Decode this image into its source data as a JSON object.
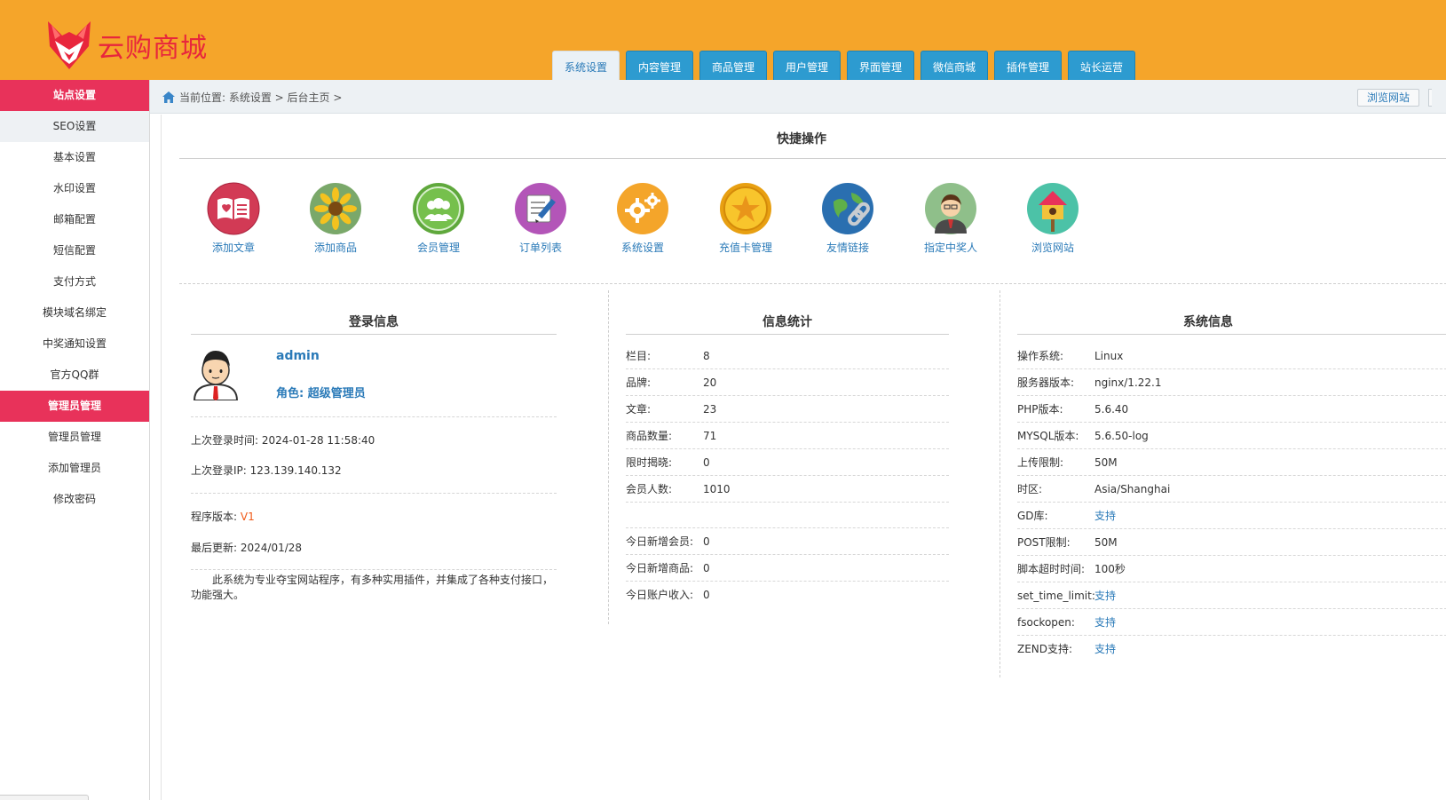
{
  "app": {
    "name": "云购商城"
  },
  "tabs": [
    {
      "label": "系统设置",
      "active": true
    },
    {
      "label": "内容管理"
    },
    {
      "label": "商品管理"
    },
    {
      "label": "用户管理"
    },
    {
      "label": "界面管理"
    },
    {
      "label": "微信商城"
    },
    {
      "label": "插件管理"
    },
    {
      "label": "站长运营"
    }
  ],
  "sidebar": {
    "group1": "站点设置",
    "items1": [
      "SEO设置",
      "基本设置",
      "水印设置",
      "邮箱配置",
      "短信配置",
      "支付方式",
      "模块域名绑定",
      "中奖通知设置",
      "官方QQ群"
    ],
    "group2": "管理员管理",
    "items2": [
      "管理员管理",
      "添加管理员",
      "修改密码"
    ]
  },
  "breadcrumb": {
    "text": "当前位置: 系统设置 > 后台主页 >"
  },
  "visit_site_button": "浏览网站",
  "quick_actions": {
    "title": "快捷操作",
    "items": [
      {
        "label": "添加文章",
        "icon": "book-icon"
      },
      {
        "label": "添加商品",
        "icon": "sunflower-icon"
      },
      {
        "label": "会员管理",
        "icon": "members-icon"
      },
      {
        "label": "订单列表",
        "icon": "notepad-icon"
      },
      {
        "label": "系统设置",
        "icon": "gears-icon"
      },
      {
        "label": "充值卡管理",
        "icon": "coin-icon"
      },
      {
        "label": "友情链接",
        "icon": "globe-link-icon"
      },
      {
        "label": "指定中奖人",
        "icon": "person-icon"
      },
      {
        "label": "浏览网站",
        "icon": "birdhouse-icon"
      }
    ]
  },
  "login_info": {
    "title": "登录信息",
    "username": "admin",
    "role": "角色: 超级管理员",
    "last_login_time": "上次登录时间: 2024-01-28 11:58:40",
    "last_login_ip": "上次登录IP: 123.139.140.132",
    "version_label": "程序版本: ",
    "version_value": "V1",
    "last_update": "最后更新: 2024/01/28",
    "description_line1": "此系统为专业夺宝网站程序，有多种实用插件，并集成了各种支付接口，功",
    "description_line2": "能强大。"
  },
  "stats": {
    "title": "信息统计",
    "rows": [
      {
        "k": "栏目:",
        "v": "8"
      },
      {
        "k": "品牌:",
        "v": "20"
      },
      {
        "k": "文章:",
        "v": "23"
      },
      {
        "k": "商品数量:",
        "v": "71"
      },
      {
        "k": "限时揭晓:",
        "v": "0"
      },
      {
        "k": "会员人数:",
        "v": "1010"
      }
    ],
    "today_rows": [
      {
        "k": "今日新增会员:",
        "v": "0"
      },
      {
        "k": "今日新增商品:",
        "v": "0"
      },
      {
        "k": "今日账户收入:",
        "v": "0"
      }
    ]
  },
  "system_info": {
    "title": "系统信息",
    "rows": [
      {
        "k": "操作系统:",
        "v": "Linux"
      },
      {
        "k": "服务器版本:",
        "v": "nginx/1.22.1"
      },
      {
        "k": "PHP版本:",
        "v": "5.6.40"
      },
      {
        "k": "MYSQL版本:",
        "v": "5.6.50-log"
      },
      {
        "k": "上传限制:",
        "v": "50M"
      },
      {
        "k": "时区:",
        "v": "Asia/Shanghai"
      },
      {
        "k": "GD库:",
        "v": "支持",
        "link": true
      },
      {
        "k": "POST限制:",
        "v": "50M"
      },
      {
        "k": "脚本超时时间:",
        "v": "100秒"
      },
      {
        "k": "set_time_limit:",
        "v": "支持",
        "link": true
      },
      {
        "k": "fsockopen:",
        "v": "支持",
        "link": true
      },
      {
        "k": "ZEND支持:",
        "v": "支持",
        "link": true
      }
    ]
  },
  "colors": {
    "header": "#f5a52a",
    "accent": "#e8325a",
    "tab": "#2d9bd0",
    "link": "#2a7ab8"
  }
}
